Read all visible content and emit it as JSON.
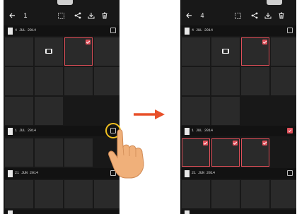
{
  "left_screen": {
    "toolbar": {
      "back_icon": "back-arrow-icon",
      "count": "1",
      "icons": [
        "select-all-icon",
        "share-icon",
        "download-icon",
        "delete-icon"
      ]
    },
    "sections": [
      {
        "date": "4 JUL 2014",
        "checked": false
      },
      {
        "date": "1 JUL 2014",
        "checked": false
      },
      {
        "date": "21 JUN 2014",
        "checked": false
      }
    ],
    "selected_photo_count": "1"
  },
  "right_screen": {
    "toolbar": {
      "back_icon": "back-arrow-icon",
      "count": "4",
      "icons": [
        "select-all-icon",
        "share-icon",
        "download-icon",
        "delete-icon"
      ]
    },
    "sections": [
      {
        "date": "4 JUL 2014",
        "checked": false
      },
      {
        "date": "1 JUL 2014",
        "checked": true
      },
      {
        "date": "21 JUN 2014",
        "checked": false
      }
    ],
    "selected_photo_count": "4"
  },
  "colors": {
    "accent": "#e0505a",
    "highlight_ring": "#f0c020",
    "arrow": "#e8502a",
    "screen_bg": "#181818",
    "cell_bg": "#2a2a2a"
  },
  "illustration": {
    "gesture": "tap-hand-icon",
    "transition": "right-arrow-icon"
  }
}
